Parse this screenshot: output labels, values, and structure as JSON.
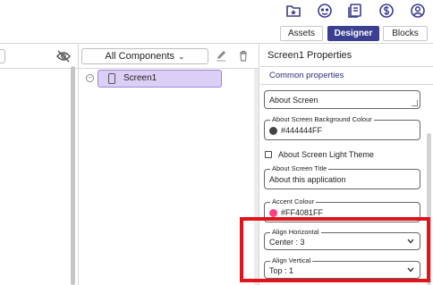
{
  "topbar": {
    "icons": [
      "new-screen-icon",
      "gallery-icon",
      "docs-icon",
      "dollar-icon",
      "account-icon"
    ]
  },
  "modes": {
    "assets": "Assets",
    "designer": "Designer",
    "blocks": "Blocks"
  },
  "components": {
    "dropdown_label": "All Components",
    "screen_name": "Screen1"
  },
  "properties": {
    "title": "Screen1 Properties",
    "section": "Common properties",
    "about_screen": {
      "value": "About Screen"
    },
    "bg_colour": {
      "label": "About Screen Background Colour",
      "value": "#444444FF",
      "color": "#444444"
    },
    "light_theme": {
      "label": "About Screen Light Theme",
      "checked": false
    },
    "about_title": {
      "label": "About Screen Title",
      "value": "About this application"
    },
    "accent_colour": {
      "label": "Accent Colour",
      "value": "#FF4081FF",
      "color": "#FF4081"
    },
    "align_horizontal": {
      "label": "Align Horizontal",
      "value": "Center : 3"
    },
    "align_vertical": {
      "label": "Align Vertical",
      "value": "Top : 1"
    }
  },
  "colors": {
    "accent": "#3b3f8f",
    "selection": "#dccff5",
    "highlight": "#e0141a"
  }
}
